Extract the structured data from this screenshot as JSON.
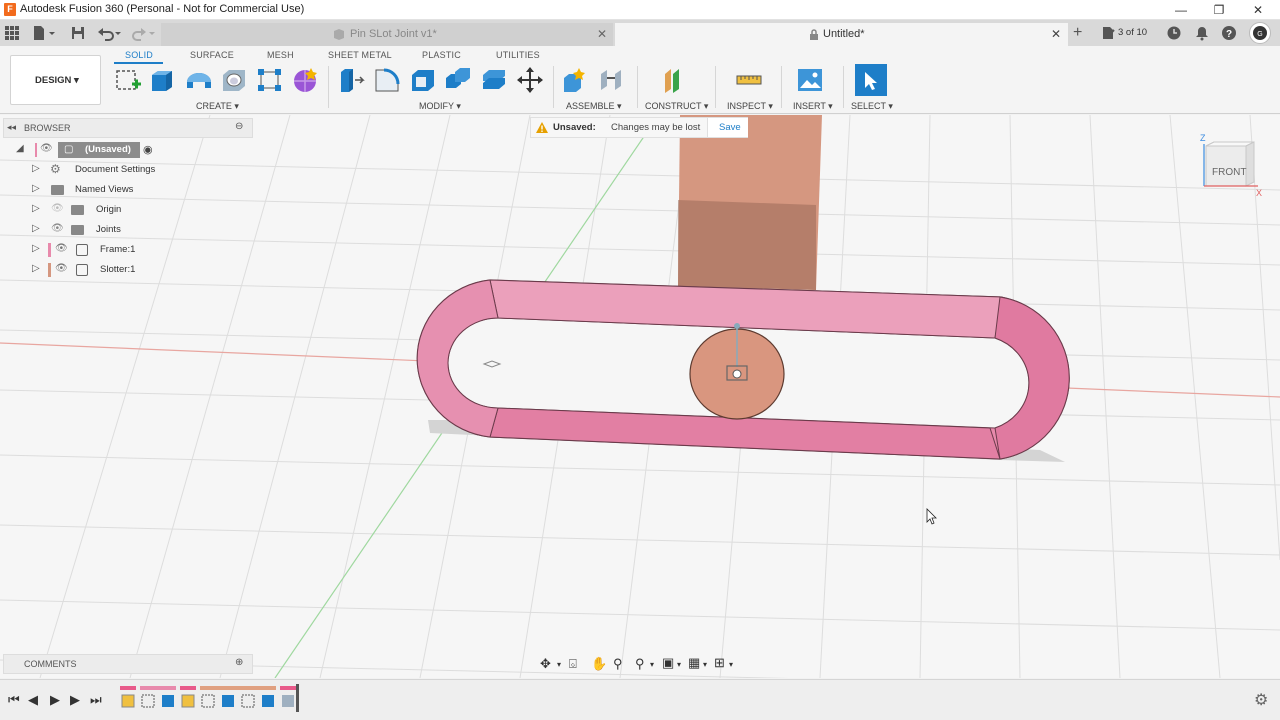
{
  "window": {
    "title": "Autodesk Fusion 360 (Personal - Not for Commercial Use)",
    "app_icon_letter": "F"
  },
  "tabs": [
    {
      "label": "Pin SLot Joint v1*",
      "active": false
    },
    {
      "label": "Untitled*",
      "active": true
    }
  ],
  "tabbar_right": {
    "counter": "3 of 10"
  },
  "ribbon": {
    "workspace": "DESIGN ▾",
    "tabs": [
      "SOLID",
      "SURFACE",
      "MESH",
      "SHEET METAL",
      "PLASTIC",
      "UTILITIES"
    ],
    "active_tab": "SOLID",
    "groups": [
      "CREATE ▾",
      "MODIFY ▾",
      "ASSEMBLE ▾",
      "CONSTRUCT ▾",
      "INSPECT ▾",
      "INSERT ▾",
      "SELECT ▾"
    ]
  },
  "browser": {
    "header": "BROWSER",
    "root": "(Unsaved)",
    "items": [
      "Document Settings",
      "Named Views",
      "Origin",
      "Joints",
      "Frame:1",
      "Slotter:1"
    ]
  },
  "unsaved_bar": {
    "label": "Unsaved:",
    "message": "Changes may be lost",
    "action": "Save"
  },
  "viewcube": {
    "face": "FRONT",
    "axis_z": "Z",
    "axis_x": "X"
  },
  "comments": {
    "header": "COMMENTS"
  },
  "colors": {
    "accent": "#1e7ec8",
    "frame_pink": "#e88aac",
    "slotter_tan": "#d59780",
    "warning": "#e6a000"
  }
}
